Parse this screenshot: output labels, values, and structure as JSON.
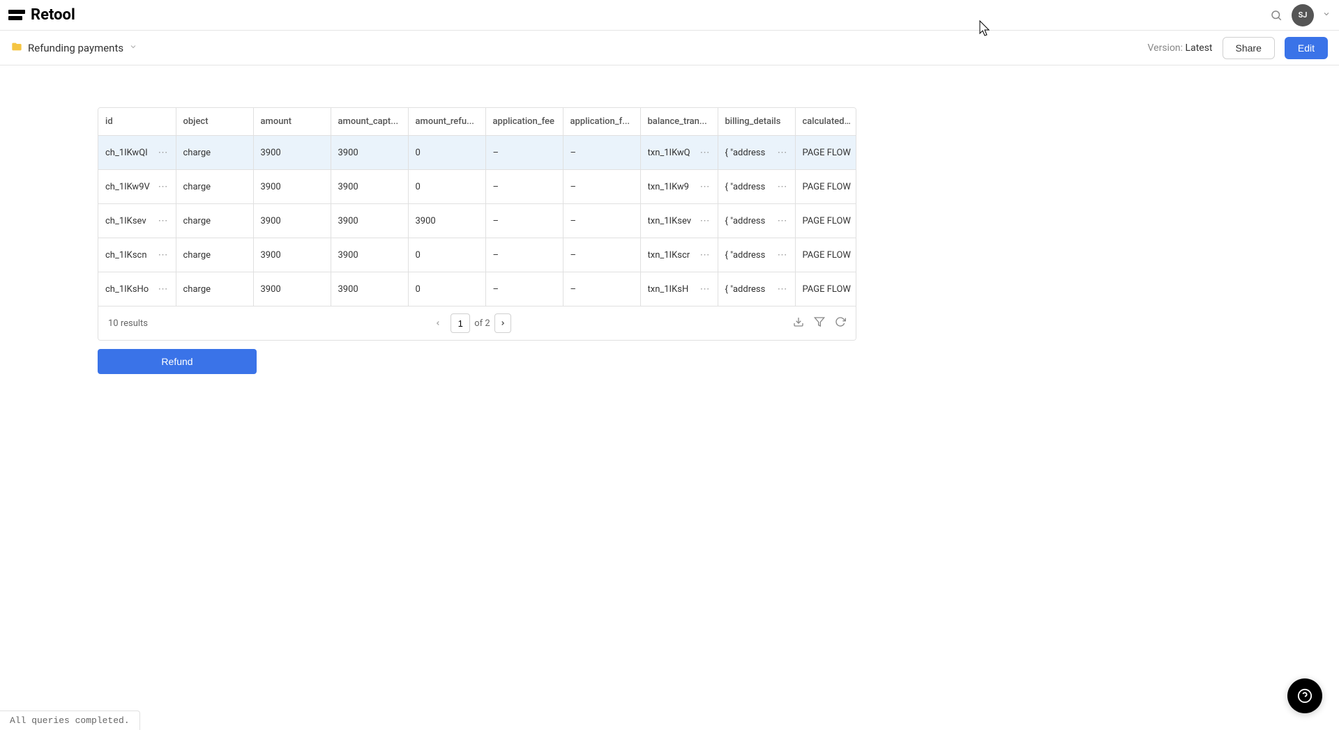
{
  "header": {
    "logo_text": "Retool",
    "avatar_initials": "SJ"
  },
  "subheader": {
    "app_name": "Refunding payments",
    "version_label": "Version:",
    "version_value": "Latest",
    "share_label": "Share",
    "edit_label": "Edit"
  },
  "table": {
    "columns": [
      "id",
      "object",
      "amount",
      "amount_capt...",
      "amount_refu...",
      "application_fee",
      "application_f...",
      "balance_tran...",
      "billing_details",
      "calculated_s"
    ],
    "rows": [
      {
        "id": "ch_1IKwQI",
        "object": "charge",
        "amount": "3900",
        "amount_captured": "3900",
        "amount_refunded": "0",
        "application_fee": "–",
        "application_fee_amount": "–",
        "balance_transaction": "txn_1IKwQ",
        "billing_details": "{ \"address",
        "calculated": "PAGE FLOW",
        "selected": true
      },
      {
        "id": "ch_1IKw9V",
        "object": "charge",
        "amount": "3900",
        "amount_captured": "3900",
        "amount_refunded": "0",
        "application_fee": "–",
        "application_fee_amount": "–",
        "balance_transaction": "txn_1IKw9",
        "billing_details": "{ \"address",
        "calculated": "PAGE FLOW",
        "selected": false
      },
      {
        "id": "ch_1IKsev",
        "object": "charge",
        "amount": "3900",
        "amount_captured": "3900",
        "amount_refunded": "3900",
        "application_fee": "–",
        "application_fee_amount": "–",
        "balance_transaction": "txn_1IKsev",
        "billing_details": "{ \"address",
        "calculated": "PAGE FLOW",
        "selected": false
      },
      {
        "id": "ch_1IKscn",
        "object": "charge",
        "amount": "3900",
        "amount_captured": "3900",
        "amount_refunded": "0",
        "application_fee": "–",
        "application_fee_amount": "–",
        "balance_transaction": "txn_1IKscr",
        "billing_details": "{ \"address",
        "calculated": "PAGE FLOW",
        "selected": false
      },
      {
        "id": "ch_1IKsHo",
        "object": "charge",
        "amount": "3900",
        "amount_captured": "3900",
        "amount_refunded": "0",
        "application_fee": "–",
        "application_fee_amount": "–",
        "balance_transaction": "txn_1IKsH",
        "billing_details": "{ \"address",
        "calculated": "PAGE FLOW",
        "selected": false
      }
    ],
    "footer": {
      "results_text": "10 results",
      "page_current": "1",
      "page_of_label": "of 2"
    }
  },
  "actions": {
    "refund_label": "Refund"
  },
  "status": {
    "message": "All queries completed."
  }
}
